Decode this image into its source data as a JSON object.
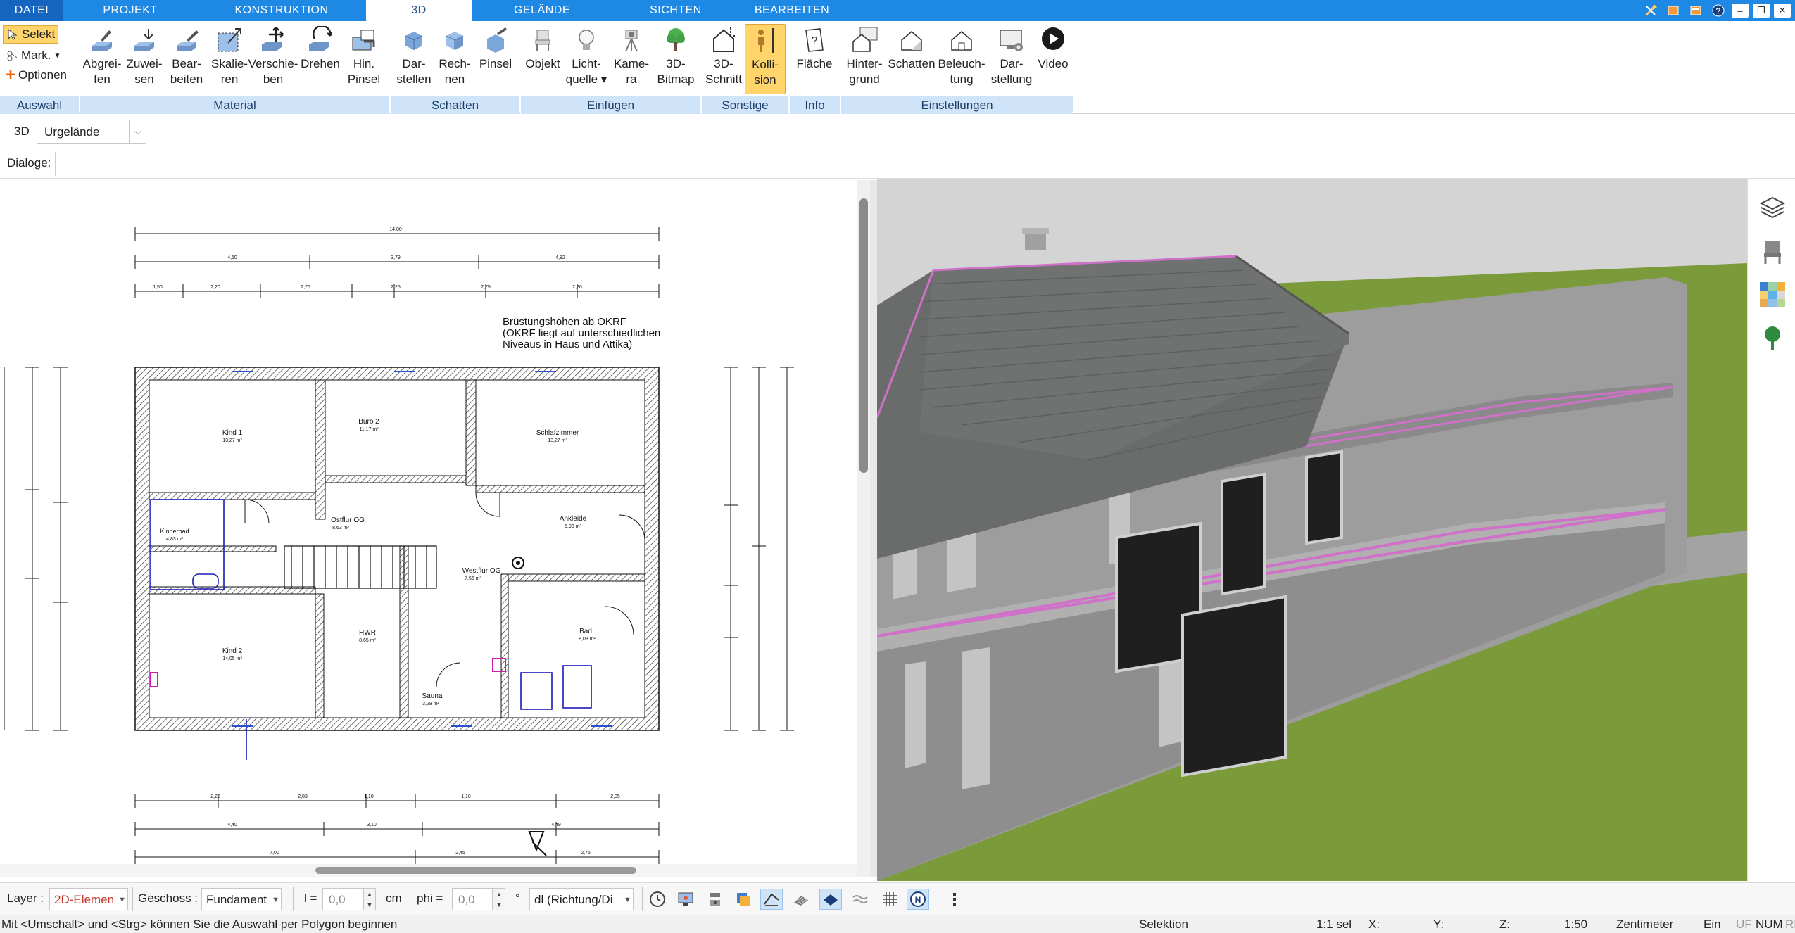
{
  "tabs": [
    {
      "label": "DATEI"
    },
    {
      "label": "PROJEKT"
    },
    {
      "label": "KONSTRUKTION"
    },
    {
      "label": "3D"
    },
    {
      "label": "GELÄNDE"
    },
    {
      "label": "SICHTEN"
    },
    {
      "label": "BEARBEITEN"
    }
  ],
  "active_tab": "3D",
  "window_controls": [
    "tools-icon",
    "layout-icon",
    "window-icon",
    "help-icon",
    "minimize",
    "restore",
    "close"
  ],
  "window_control_glyphs": {
    "minimize": "–",
    "restore": "❐",
    "close": "✕"
  },
  "ribbon": {
    "auswahl": {
      "label": "Auswahl",
      "selekt": "Selekt",
      "mark": "Mark.",
      "optionen": "Optionen"
    },
    "material": {
      "label": "Material",
      "buttons": [
        {
          "label": "Abgrei-\nfen",
          "icon": "eyedropper-icon"
        },
        {
          "label": "Zuwei-\nsen",
          "icon": "assign-material-icon"
        },
        {
          "label": "Bear-\nbeiten",
          "icon": "edit-material-icon"
        },
        {
          "label": "Skalie-\nren",
          "icon": "scale-icon"
        },
        {
          "label": "Verschie-\nben",
          "icon": "move-icon"
        },
        {
          "label": "Drehen",
          "icon": "rotate-icon"
        },
        {
          "label": "Hin.\nPinsel",
          "icon": "background-brush-icon"
        }
      ]
    },
    "schatten": {
      "label": "Schatten",
      "buttons": [
        {
          "label": "Dar-\nstellen",
          "icon": "shadow-display-icon"
        },
        {
          "label": "Rech-\nnen",
          "icon": "shadow-compute-icon"
        },
        {
          "label": "Pinsel",
          "icon": "shadow-brush-icon"
        }
      ]
    },
    "einfuegen": {
      "label": "Einfügen",
      "buttons": [
        {
          "label": "Objekt",
          "icon": "chair-icon"
        },
        {
          "label": "Licht-\nquelle ▾",
          "icon": "lightbulb-icon"
        },
        {
          "label": "Kame-\nra",
          "icon": "camera-icon"
        },
        {
          "label": "3D-\nBitmap",
          "icon": "tree-icon"
        }
      ]
    },
    "sonstige": {
      "label": "Sonstige",
      "buttons": [
        {
          "label": "3D-\nSchnitt",
          "icon": "section-cut-icon"
        },
        {
          "label": "Kolli-\nsion",
          "icon": "collision-person-icon",
          "active": true
        }
      ]
    },
    "info": {
      "label": "Info",
      "buttons": [
        {
          "label": "Fläche",
          "icon": "area-info-icon"
        }
      ]
    },
    "einstellungen": {
      "label": "Einstellungen",
      "buttons": [
        {
          "label": "Hinter-\ngrund",
          "icon": "background-house-icon"
        },
        {
          "label": "Schatten",
          "icon": "shadow-house-icon"
        },
        {
          "label": "Beleuch-\ntung",
          "icon": "lighting-house-icon"
        },
        {
          "label": "Dar-\nstellung",
          "icon": "display-settings-icon"
        },
        {
          "label": "Video",
          "icon": "video-play-icon"
        }
      ]
    }
  },
  "viewbar": {
    "mode_label": "3D",
    "terrain_value": "Urgelände"
  },
  "dialogbar": {
    "label": "Dialoge:"
  },
  "plan": {
    "note_lines": [
      "Brüstungshöhen ab OKRF",
      "(OKRF liegt auf unterschiedlichen",
      "Niveaus in Haus und Attika)"
    ],
    "rooms": [
      {
        "name": "Kind 1",
        "area": "13,27 m²"
      },
      {
        "name": "Büro 2",
        "area": "11,17 m²"
      },
      {
        "name": "Schlafzimmer",
        "area": "13,27 m²"
      },
      {
        "name": "Kinderbad",
        "area": "4,83 m²"
      },
      {
        "name": "Ostflur OG",
        "area": "8,63 m²"
      },
      {
        "name": "Ankleide",
        "area": "5,93 m²"
      },
      {
        "name": "Westflur OG",
        "area": "7,56 m²"
      },
      {
        "name": "HWR",
        "area": "8,65 m²"
      },
      {
        "name": "Bad",
        "area": "8,03 m²"
      },
      {
        "name": "Kind 2",
        "area": "14,05 m²"
      },
      {
        "name": "Sauna",
        "area": "3,28 m²"
      }
    ],
    "dims_top": [
      "14,00",
      "4,50",
      "3,79",
      "4,82",
      "1,50",
      "2,20",
      "2,75",
      "2,25",
      "2,75",
      "2,20"
    ],
    "dims_bottom": [
      "2,20",
      "2,83",
      "1,10",
      "1,10",
      "2,05",
      "4,40",
      "3,10",
      "4,49",
      "7,00",
      "2,45",
      "2,75"
    ]
  },
  "bottombar": {
    "layer_label": "Layer :",
    "layer_value": "2D-Elemen",
    "geschoss_label": "Geschoss :",
    "geschoss_value": "Fundament",
    "l_label": "l =",
    "l_value": "0,0",
    "l_unit": "cm",
    "phi_label": "phi =",
    "phi_value": "0,0",
    "phi_unit": "°",
    "direction_value": "dl (Richtung/Di",
    "tools": [
      "clock-icon",
      "screen-icon",
      "dimension-icon",
      "layers-3d-icon",
      "roof-icon",
      "hatch-icon",
      "plane-icon",
      "wave-icon",
      "grid-icon",
      "north-icon",
      "more-icon"
    ]
  },
  "status": {
    "hint": "Mit <Umschalt> und <Strg> können Sie die Auswahl per Polygon beginnen",
    "mode": "Selektion",
    "sel": "1:1 sel",
    "x": "X:",
    "y": "Y:",
    "z": "Z:",
    "scale": "1:50",
    "unit": "Zentimeter",
    "ein": "Ein",
    "uf": "UF",
    "num": "NUM",
    "rf": "RF"
  },
  "colors": {
    "accent": "#1e88e5",
    "ribbon_group": "#cfe4f8",
    "highlight": "#ffd46b",
    "grass": "#7a9a3c",
    "roof": "#6f7171",
    "wall": "#9a9a9a",
    "magenta": "#d070c8"
  }
}
